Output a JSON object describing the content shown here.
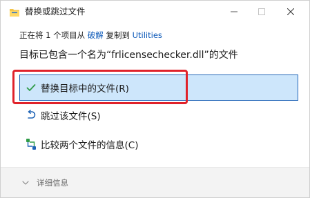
{
  "window": {
    "title": "替换或跳过文件"
  },
  "status": {
    "prefix": "正在将 1 个项目从",
    "source": "破解",
    "middle": "复制到",
    "destination": "Utilities"
  },
  "question": "目标已包含一个名为“frlicensechecker.dll”的文件",
  "options": [
    {
      "label": "替换目标中的文件(R)",
      "icon": "checkmark-icon",
      "selected": true
    },
    {
      "label": "跳过该文件(S)",
      "icon": "skip-arrow-icon",
      "selected": false
    },
    {
      "label": "比较两个文件的信息(C)",
      "icon": "compare-icon",
      "selected": false
    }
  ],
  "footer": {
    "details_label": "详细信息"
  },
  "colors": {
    "accent": "#1e63b6",
    "selected_bg": "#cde6fb",
    "link": "#0b58b8",
    "annotation_red": "#e0222a",
    "check_green": "#2e9b47"
  }
}
